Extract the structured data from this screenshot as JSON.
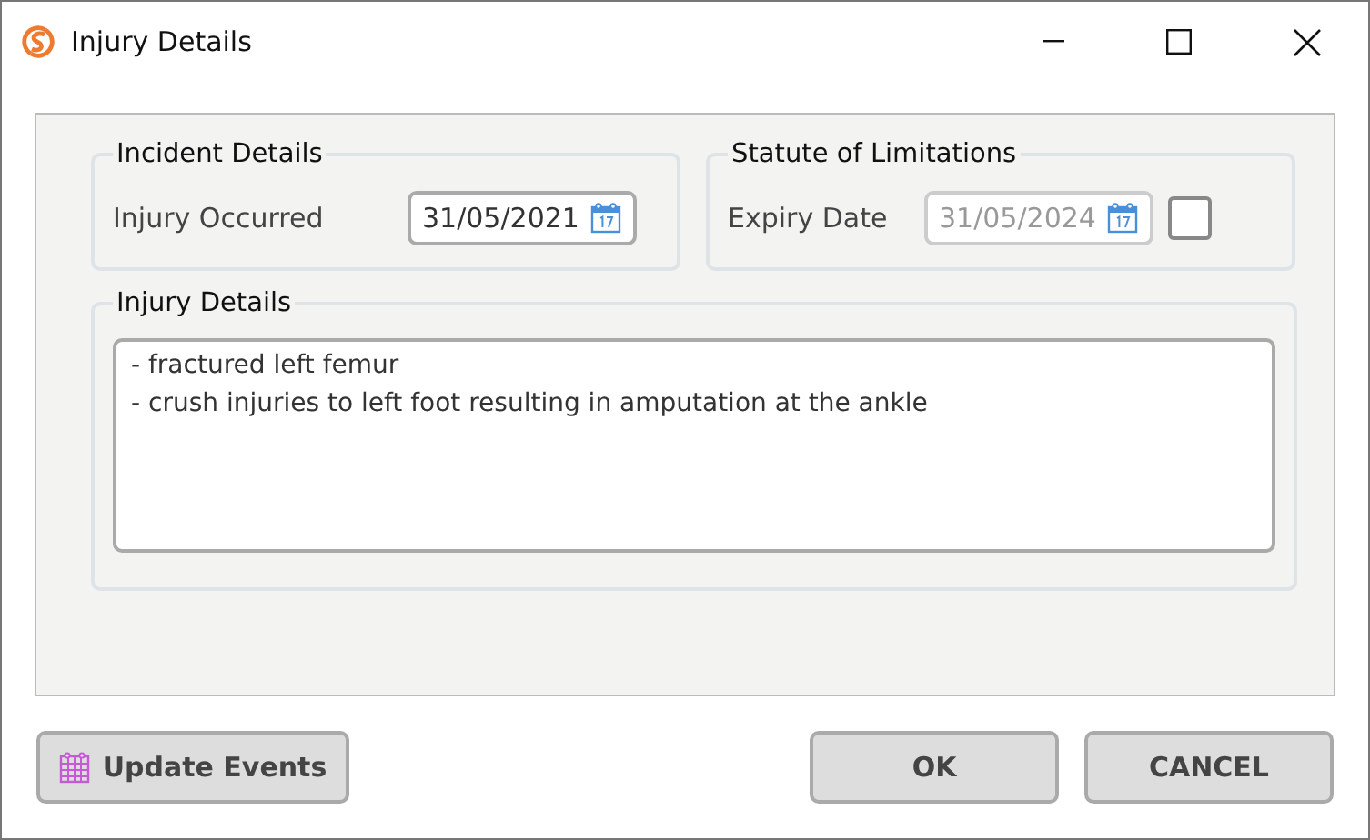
{
  "window": {
    "title": "Injury Details"
  },
  "incident": {
    "legend": "Incident Details",
    "label": "Injury Occurred",
    "date": "31/05/2021",
    "disabled": false
  },
  "statute": {
    "legend": "Statute of Limitations",
    "label": "Expiry Date",
    "date": "31/05/2024",
    "disabled": true,
    "checked": false
  },
  "details": {
    "legend": "Injury Details",
    "lines": [
      "- fractured left femur",
      "- crush injuries to left foot resulting in amputation at the ankle"
    ]
  },
  "buttons": {
    "update": "Update Events",
    "ok": "OK",
    "cancel": "CANCEL"
  }
}
